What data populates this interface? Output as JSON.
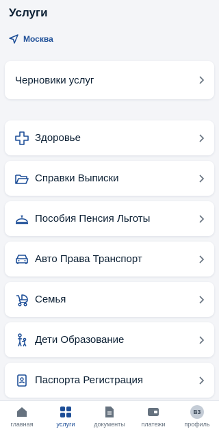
{
  "header": {
    "title": "Услуги"
  },
  "location": {
    "city": "Москва"
  },
  "drafts": {
    "label": "Черновики услуг"
  },
  "services": [
    {
      "label": "Здоровье",
      "icon": "medical-cross-icon"
    },
    {
      "label": "Справки Выписки",
      "icon": "folder-icon"
    },
    {
      "label": "Пособия Пенсия Льготы",
      "icon": "cloche-icon"
    },
    {
      "label": "Авто Права Транспорт",
      "icon": "car-icon"
    },
    {
      "label": "Семья",
      "icon": "stroller-icon"
    },
    {
      "label": "Дети Образование",
      "icon": "parent-child-icon"
    },
    {
      "label": "Паспорта Регистрация",
      "icon": "passport-icon"
    }
  ],
  "nav": {
    "home": "главная",
    "services": "услуги",
    "documents": "документы",
    "payments": "платежи",
    "profile": "профиль",
    "avatar_initials": "ВЗ",
    "active": "services"
  },
  "colors": {
    "accent": "#1d4e97",
    "text": "#0b1f33",
    "background": "#f4f5f8",
    "card": "#ffffff",
    "inactive": "#66727f"
  }
}
